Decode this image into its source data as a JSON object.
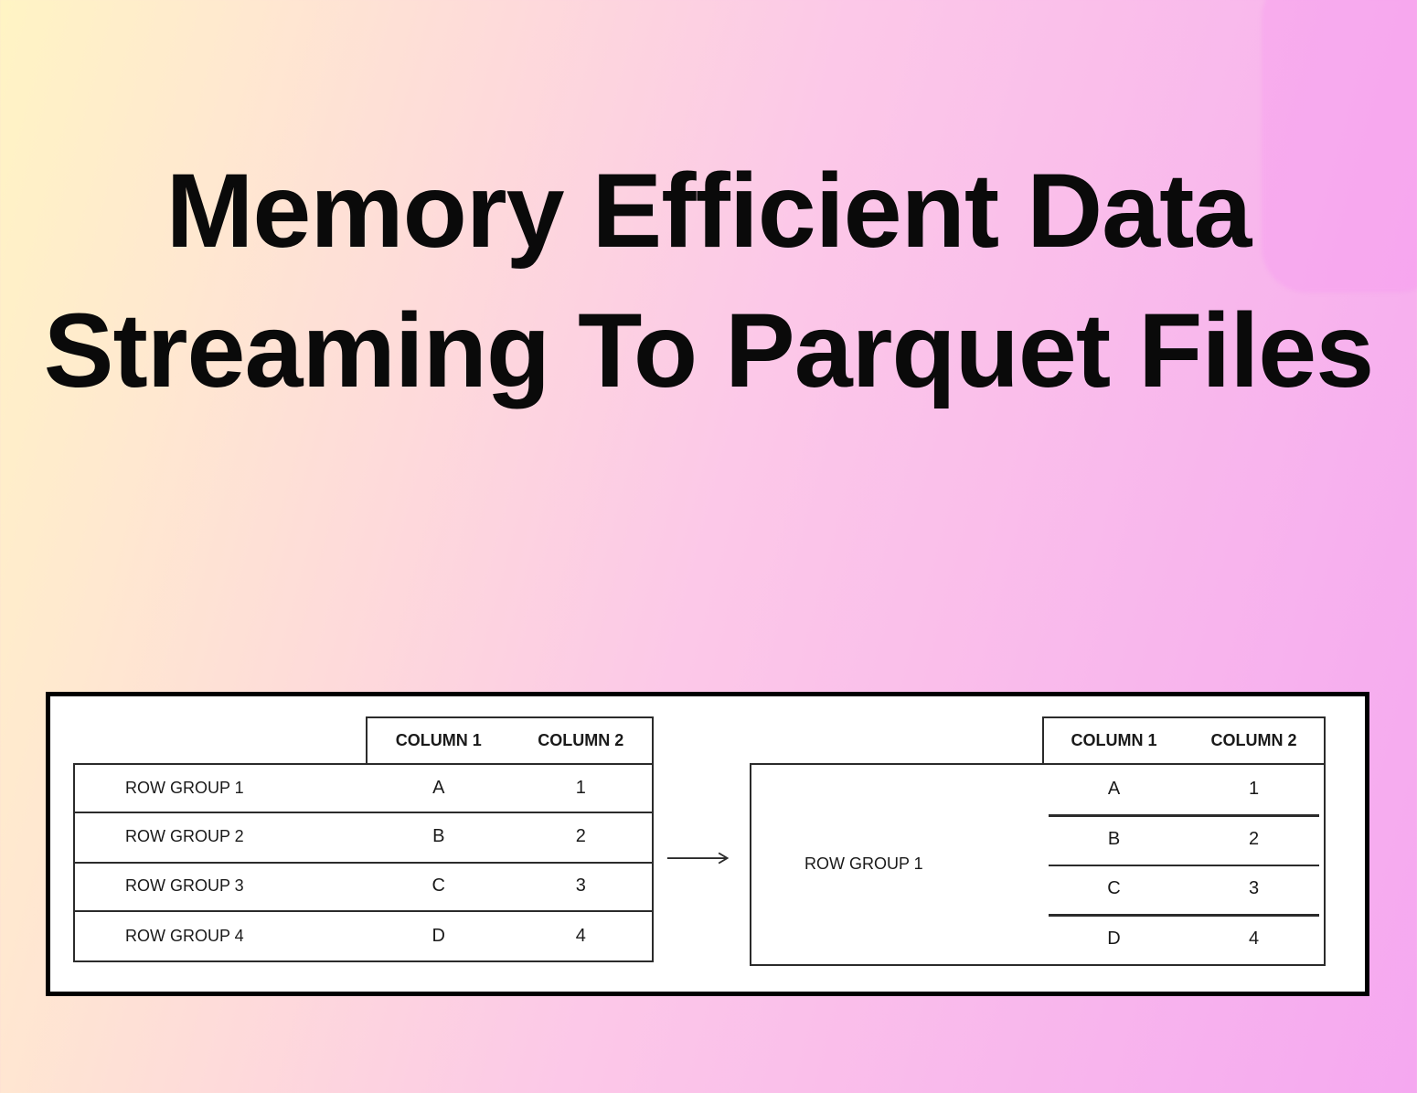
{
  "title": "Memory Efficient Data Streaming To Parquet Files",
  "diagram": {
    "left": {
      "headers": [
        "COLUMN 1",
        "COLUMN 2"
      ],
      "rows": [
        {
          "label": "ROW GROUP 1",
          "c1": "A",
          "c2": "1"
        },
        {
          "label": "ROW GROUP 2",
          "c1": "B",
          "c2": "2"
        },
        {
          "label": "ROW GROUP 3",
          "c1": "C",
          "c2": "3"
        },
        {
          "label": "ROW GROUP 4",
          "c1": "D",
          "c2": "4"
        }
      ]
    },
    "right": {
      "headers": [
        "COLUMN 1",
        "COLUMN 2"
      ],
      "label": "ROW GROUP 1",
      "rows": [
        {
          "c1": "A",
          "c2": "1"
        },
        {
          "c1": "B",
          "c2": "2"
        },
        {
          "c1": "C",
          "c2": "3"
        },
        {
          "c1": "D",
          "c2": "4"
        }
      ]
    }
  }
}
